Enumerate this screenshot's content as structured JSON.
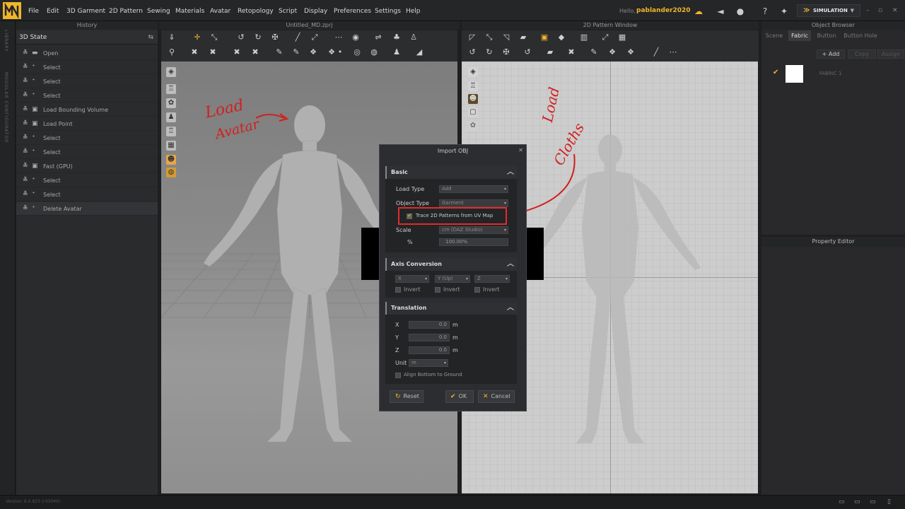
{
  "menubar": {
    "items": [
      "File",
      "Edit",
      "3D Garment",
      "2D Pattern",
      "Sewing",
      "Materials",
      "Avatar",
      "Retopology",
      "Script",
      "Display",
      "Preferences",
      "Settings",
      "Help"
    ],
    "hello": "Hello,",
    "username": "pablander2020",
    "simulation_label": "SIMULATION"
  },
  "left_strip": {
    "library": "LIBRARY",
    "modular": "MODULAR CONFIGURATOR"
  },
  "history": {
    "title": "History",
    "state_label": "3D State",
    "rows": [
      "Open",
      "Select",
      "Select",
      "Select",
      "Load Bounding Volume",
      "Load Point",
      "Select",
      "Select",
      "Fast (GPU)",
      "Select",
      "Select",
      "Delete Avatar"
    ]
  },
  "panel3d": {
    "title": "Untitled_MD.zprj"
  },
  "panel2d": {
    "title": "2D Pattern Window"
  },
  "object_browser": {
    "title": "Object Browser",
    "tabs": [
      "Scene",
      "Fabric",
      "Button",
      "Button Hole"
    ],
    "active_tab": "Fabric",
    "add": "+ Add",
    "copy": "Copy",
    "assign": "Assign",
    "fabric_name": "FABRIC 1"
  },
  "property_editor": {
    "title": "Property Editor"
  },
  "status": {
    "version": "Version: 6.0.623 (r33040)"
  },
  "annotations": {
    "load_avatar_1": "Load",
    "load_avatar_2": "Avatar",
    "load_cloths_1": "Load",
    "load_cloths_2": "Cloths"
  },
  "dialog": {
    "title": "Import OBJ",
    "basic": {
      "header": "Basic",
      "load_type_label": "Load Type",
      "load_type_value": "Add",
      "object_type_label": "Object Type",
      "object_type_value": "Garment",
      "trace_label": "Trace 2D Patterns from UV Map",
      "trace_checked": true,
      "scale_label": "Scale",
      "scale_value": "cm (DAZ Studio)",
      "percent_label": "%",
      "percent_value": "100.00%"
    },
    "axis": {
      "header": "Axis Conversion",
      "x": "X",
      "y": "Y (Up)",
      "z": "Z",
      "invert": "Invert"
    },
    "translation": {
      "header": "Translation",
      "x_label": "X",
      "y_label": "Y",
      "z_label": "Z",
      "x_value": "0.0",
      "y_value": "0.0",
      "z_value": "0.0",
      "unit_m": "m",
      "unit_label": "Unit",
      "unit_value": "m",
      "align_label": "Align Bottom to Ground"
    },
    "buttons": {
      "reset": "Reset",
      "ok": "OK",
      "cancel": "Cancel"
    }
  },
  "colors": {
    "accent": "#f0b62a",
    "annotation": "#d21f1f",
    "highlight": "#e32a2a"
  }
}
